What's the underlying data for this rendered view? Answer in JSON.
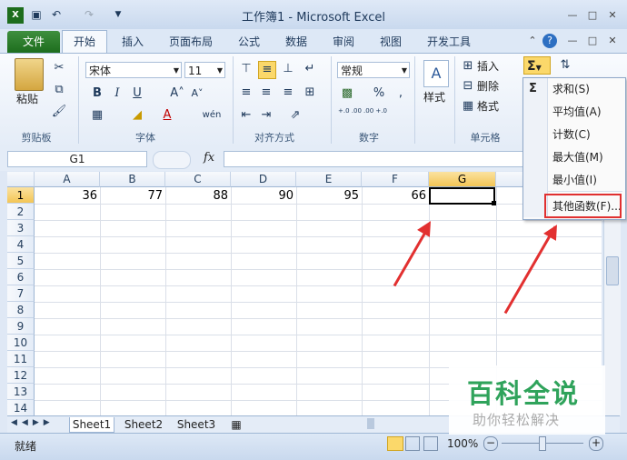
{
  "window": {
    "title": "工作簿1 - Microsoft Excel",
    "quick_access": [
      "save-icon",
      "undo-icon",
      "redo-icon",
      "customize-icon"
    ],
    "controls": [
      "minimize",
      "restore",
      "close"
    ]
  },
  "tabs": [
    "文件",
    "开始",
    "插入",
    "页面布局",
    "公式",
    "数据",
    "审阅",
    "视图",
    "开发工具"
  ],
  "ribbon": {
    "clipboard": {
      "paste": "粘贴",
      "group": "剪贴板"
    },
    "font": {
      "name": "宋体",
      "size": "11",
      "group": "字体",
      "bold": "B",
      "italic": "I",
      "underline": "U",
      "wen": "wén"
    },
    "alignment": {
      "group": "对齐方式"
    },
    "number": {
      "format": "常规",
      "percent": "%",
      "comma": ",",
      "dec_inc": "+.0 .00",
      "dec_dec": ".00 +.0",
      "group": "数字"
    },
    "styles": {
      "label": "样式"
    },
    "cells": {
      "insert": "插入",
      "delete": "删除",
      "format": "格式",
      "group": "单元格"
    }
  },
  "formula_bar": {
    "name_box": "G1",
    "fx": "fx",
    "value": ""
  },
  "grid": {
    "columns": [
      "A",
      "B",
      "C",
      "D",
      "E",
      "F",
      "G"
    ],
    "rows": [
      "1",
      "2",
      "3",
      "4",
      "5",
      "6",
      "7",
      "8",
      "9",
      "10",
      "11",
      "12",
      "13",
      "14"
    ],
    "row1_values": [
      "36",
      "77",
      "88",
      "90",
      "95",
      "66",
      ""
    ],
    "selected_cell": "G1"
  },
  "sheets": [
    "Sheet1",
    "Sheet2",
    "Sheet3"
  ],
  "status": {
    "text": "就绪",
    "zoom": "100%"
  },
  "autosum_menu": {
    "items": [
      "求和(S)",
      "平均值(A)",
      "计数(C)",
      "最大值(M)",
      "最小值(I)",
      "其他函数(F)..."
    ],
    "highlighted": "其他函数(F)..."
  },
  "watermark": {
    "title": "百科全说",
    "subtitle": "助你轻松解决"
  },
  "colors": {
    "accent_red": "#e03030",
    "excel_green": "#1d6d1d",
    "watermark_green": "#2fa35b"
  }
}
